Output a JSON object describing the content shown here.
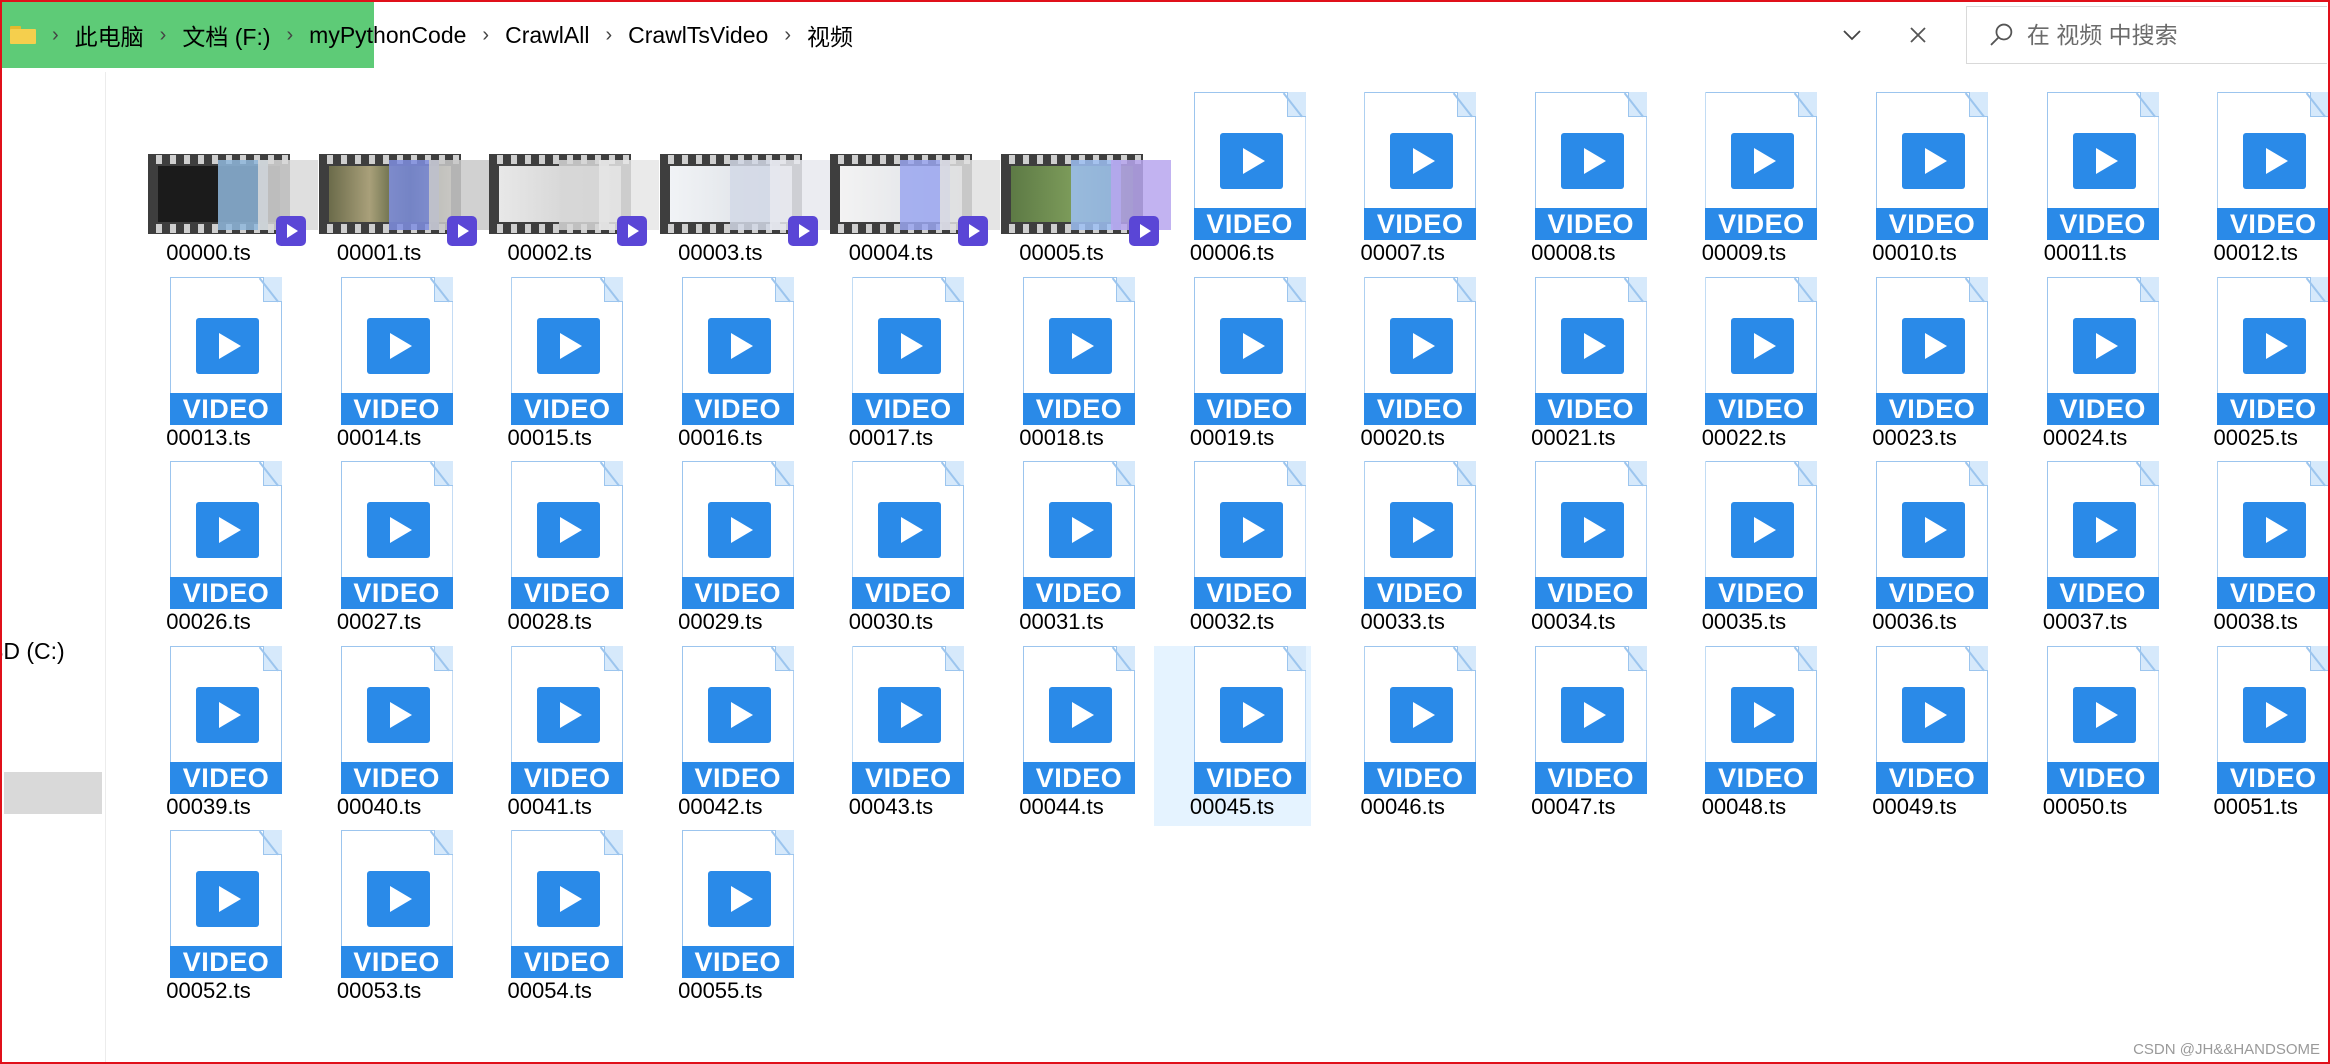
{
  "address_bar": {
    "breadcrumbs": [
      "此电脑",
      "文档 (F:)",
      "myPythonCode",
      "CrawlAll",
      "CrawlTsVideo",
      "视频"
    ],
    "search_placeholder": "在 视频 中搜索"
  },
  "nav_pane": {
    "drive_label": "SD (C:)"
  },
  "icon_band_text": "VIDEO",
  "files": [
    {
      "name": "00000.ts",
      "icon": "video-thumbnail"
    },
    {
      "name": "00001.ts",
      "icon": "video-thumbnail"
    },
    {
      "name": "00002.ts",
      "icon": "video-thumbnail"
    },
    {
      "name": "00003.ts",
      "icon": "video-thumbnail"
    },
    {
      "name": "00004.ts",
      "icon": "video-thumbnail"
    },
    {
      "name": "00005.ts",
      "icon": "video-thumbnail"
    },
    {
      "name": "00006.ts",
      "icon": "video-file-icon"
    },
    {
      "name": "00007.ts",
      "icon": "video-file-icon"
    },
    {
      "name": "00008.ts",
      "icon": "video-file-icon"
    },
    {
      "name": "00009.ts",
      "icon": "video-file-icon"
    },
    {
      "name": "00010.ts",
      "icon": "video-file-icon"
    },
    {
      "name": "00011.ts",
      "icon": "video-file-icon"
    },
    {
      "name": "00012.ts",
      "icon": "video-file-icon"
    },
    {
      "name": "00013.ts",
      "icon": "video-file-icon"
    },
    {
      "name": "00014.ts",
      "icon": "video-file-icon"
    },
    {
      "name": "00015.ts",
      "icon": "video-file-icon"
    },
    {
      "name": "00016.ts",
      "icon": "video-file-icon"
    },
    {
      "name": "00017.ts",
      "icon": "video-file-icon"
    },
    {
      "name": "00018.ts",
      "icon": "video-file-icon"
    },
    {
      "name": "00019.ts",
      "icon": "video-file-icon"
    },
    {
      "name": "00020.ts",
      "icon": "video-file-icon"
    },
    {
      "name": "00021.ts",
      "icon": "video-file-icon"
    },
    {
      "name": "00022.ts",
      "icon": "video-file-icon"
    },
    {
      "name": "00023.ts",
      "icon": "video-file-icon"
    },
    {
      "name": "00024.ts",
      "icon": "video-file-icon"
    },
    {
      "name": "00025.ts",
      "icon": "video-file-icon"
    },
    {
      "name": "00026.ts",
      "icon": "video-file-icon"
    },
    {
      "name": "00027.ts",
      "icon": "video-file-icon"
    },
    {
      "name": "00028.ts",
      "icon": "video-file-icon"
    },
    {
      "name": "00029.ts",
      "icon": "video-file-icon"
    },
    {
      "name": "00030.ts",
      "icon": "video-file-icon"
    },
    {
      "name": "00031.ts",
      "icon": "video-file-icon"
    },
    {
      "name": "00032.ts",
      "icon": "video-file-icon"
    },
    {
      "name": "00033.ts",
      "icon": "video-file-icon"
    },
    {
      "name": "00034.ts",
      "icon": "video-file-icon"
    },
    {
      "name": "00035.ts",
      "icon": "video-file-icon"
    },
    {
      "name": "00036.ts",
      "icon": "video-file-icon"
    },
    {
      "name": "00037.ts",
      "icon": "video-file-icon"
    },
    {
      "name": "00038.ts",
      "icon": "video-file-icon"
    },
    {
      "name": "00039.ts",
      "icon": "video-file-icon"
    },
    {
      "name": "00040.ts",
      "icon": "video-file-icon"
    },
    {
      "name": "00041.ts",
      "icon": "video-file-icon"
    },
    {
      "name": "00042.ts",
      "icon": "video-file-icon"
    },
    {
      "name": "00043.ts",
      "icon": "video-file-icon"
    },
    {
      "name": "00044.ts",
      "icon": "video-file-icon"
    },
    {
      "name": "00045.ts",
      "icon": "video-file-icon",
      "selected": true
    },
    {
      "name": "00046.ts",
      "icon": "video-file-icon"
    },
    {
      "name": "00047.ts",
      "icon": "video-file-icon"
    },
    {
      "name": "00048.ts",
      "icon": "video-file-icon"
    },
    {
      "name": "00049.ts",
      "icon": "video-file-icon"
    },
    {
      "name": "00050.ts",
      "icon": "video-file-icon"
    },
    {
      "name": "00051.ts",
      "icon": "video-file-icon"
    },
    {
      "name": "00052.ts",
      "icon": "video-file-icon"
    },
    {
      "name": "00053.ts",
      "icon": "video-file-icon"
    },
    {
      "name": "00054.ts",
      "icon": "video-file-icon"
    },
    {
      "name": "00055.ts",
      "icon": "video-file-icon"
    }
  ],
  "colors": {
    "accent": "#2a8ae8",
    "crumb_highlight": "#5ecb77",
    "frame_border": "#e0101a",
    "selection": "#e5f3ff"
  },
  "watermark": "CSDN @JH&&HANDSOME"
}
